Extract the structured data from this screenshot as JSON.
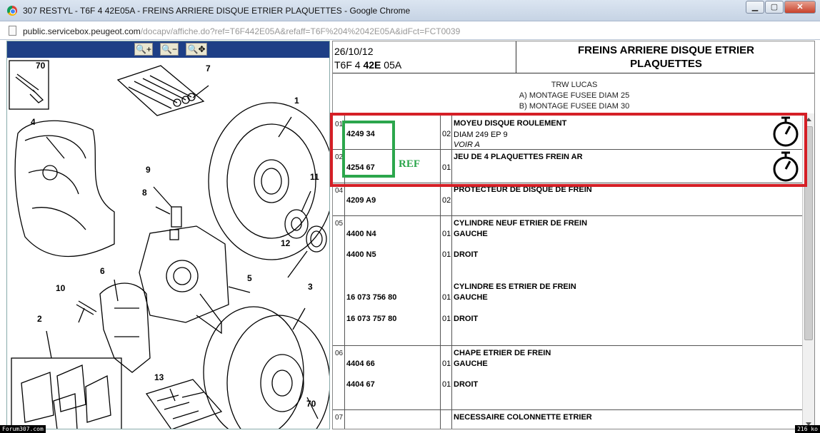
{
  "window": {
    "title": "307 RESTYL - T6F 4 42E05A - FREINS ARRIERE DISQUE ETRIER PLAQUETTES - Google Chrome",
    "minimize": "▁",
    "maximize": "▢",
    "close": "✕"
  },
  "url": {
    "host": "public.servicebox.peugeot.com",
    "path": "/docapv/affiche.do?ref=T6F442E05A&refaff=T6F%204%2042E05A&idFct=FCT0039"
  },
  "zoom": {
    "zoom_in": "🔍+",
    "zoom_out": "🔍−",
    "zoom_fit": "🔍✥"
  },
  "diagram": {
    "callouts": [
      "70",
      "7",
      "1",
      "4",
      "9",
      "8",
      "11",
      "6",
      "12",
      "10",
      "5",
      "3",
      "2",
      "13",
      "70"
    ]
  },
  "header": {
    "date": "26/10/12",
    "code_a": "T6F 4 ",
    "code_b": "42E",
    "code_c": " 05A",
    "title_line1": "FREINS ARRIERE DISQUE ETRIER",
    "title_line2": "PLAQUETTES"
  },
  "subheader": {
    "line1": "TRW LUCAS",
    "line2": "A) MONTAGE FUSEE DIAM 25",
    "line3": "B) MONTAGE FUSEE DIAM 30"
  },
  "parts": {
    "r1": {
      "num": "01",
      "ref": "4249 34",
      "qty": "02",
      "title": "MOYEU DISQUE ROULEMENT",
      "detail": "DIAM 249 EP 9",
      "note": "VOIR A"
    },
    "r2": {
      "num": "02",
      "ref": "4254 67",
      "qty": "01",
      "title": "JEU DE 4 PLAQUETTES FREIN AR"
    },
    "r3": {
      "num": "04",
      "ref": "4209 A9",
      "qty": "02",
      "title": "PROTECTEUR DE DISQUE DE FREIN"
    },
    "r4": {
      "num": "05",
      "title": "CYLINDRE NEUF ETRIER DE FREIN",
      "ref1": "4400 N4",
      "qty1": "01",
      "sub1": "GAUCHE",
      "ref2": "4400 N5",
      "qty2": "01",
      "sub2": "DROIT",
      "title2": "CYLINDRE ES ETRIER DE FREIN",
      "ref3": "16 073 756 80",
      "qty3": "01",
      "sub3": "GAUCHE",
      "ref4": "16 073 757 80",
      "qty4": "01",
      "sub4": "DROIT"
    },
    "r5": {
      "num": "06",
      "title": "CHAPE ETRIER DE FREIN",
      "ref1": "4404 66",
      "qty1": "01",
      "sub1": "GAUCHE",
      "ref2": "4404 67",
      "qty2": "01",
      "sub2": "DROIT"
    },
    "r6": {
      "num": "07",
      "title": "NECESSAIRE COLONNETTE ETRIER"
    }
  },
  "annotation": {
    "ref_label": "REF",
    "red_box_color": "#d51f26",
    "green_box_color": "#2ca64c"
  },
  "footer": {
    "left": "Forum307.com",
    "right": "216 ko"
  },
  "icons": [
    "chrome-logo-icon",
    "page-icon",
    "zoom-in-icon",
    "zoom-out-icon",
    "zoom-fit-icon",
    "stopwatch-icon"
  ]
}
